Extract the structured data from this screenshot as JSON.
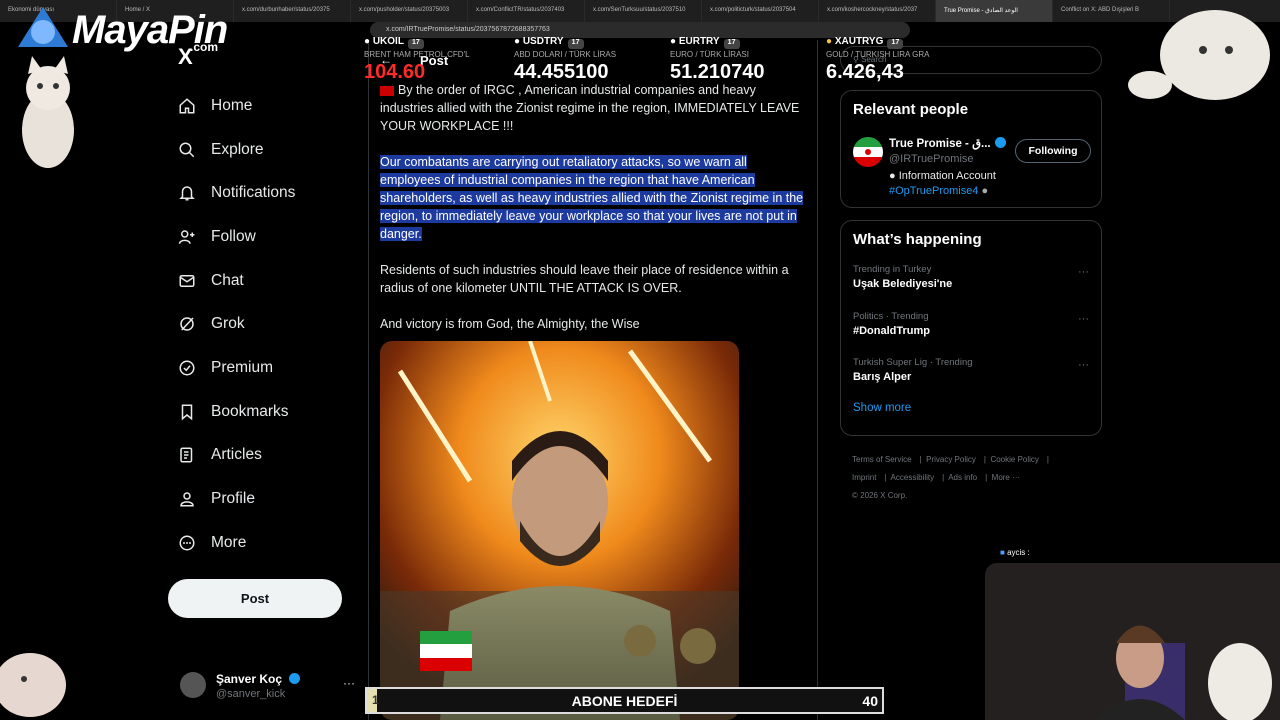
{
  "browser": {
    "tabs": [
      "Ekonomi dünyası",
      "Home / X",
      "x.com/durbunhaber/status/20375",
      "x.com/pusholder/status/20375003",
      "x.com/ConflictTR/status/2037403",
      "x.com/SenTurksuu/status/2037510",
      "x.com/politicturk/status/2037504",
      "x.com/koshercockney/status/2037",
      "True Promise - الوعد الصادق",
      "Conflict on X: ABD Dışişleri B"
    ],
    "url": "x.com/IRTruePromise/status/2037567872688357763"
  },
  "overlay": {
    "logo_text": "MayaPin",
    "logo_suffix": ".com",
    "sub_goal_label": "ABONE HEDEFİ",
    "sub_goal_start": "1",
    "sub_goal_target": "40",
    "sub_goal_progress": 0.01,
    "chat_user": "aycis :"
  },
  "ticker": [
    {
      "symbol": "UKOIL",
      "desc": "BRENT HAM PETROL CFD'L",
      "value": "104.60",
      "color": "#ff2a2a"
    },
    {
      "symbol": "USDTRY",
      "desc": "ABD DOLARI / TÜRK LİRAS",
      "value": "44.455100",
      "color": "#ffffff"
    },
    {
      "symbol": "EURTRY",
      "desc": "EURO / TÜRK LİRASI",
      "value": "51.210740",
      "color": "#ffffff"
    },
    {
      "symbol": "XAUTRYG",
      "desc": "GOLD / TURKISH LIRA GRA",
      "value": "6.426,43",
      "color": "#ffffff"
    }
  ],
  "sidebar": {
    "logo": "X",
    "items": [
      {
        "label": "Home",
        "icon": "home-icon"
      },
      {
        "label": "Explore",
        "icon": "search-icon"
      },
      {
        "label": "Notifications",
        "icon": "bell-icon"
      },
      {
        "label": "Follow",
        "icon": "add-person-icon"
      },
      {
        "label": "Chat",
        "icon": "mail-icon"
      },
      {
        "label": "Grok",
        "icon": "grok-icon"
      },
      {
        "label": "Premium",
        "icon": "verified-icon"
      },
      {
        "label": "Bookmarks",
        "icon": "bookmark-icon"
      },
      {
        "label": "Articles",
        "icon": "article-icon"
      },
      {
        "label": "Profile",
        "icon": "person-icon"
      },
      {
        "label": "More",
        "icon": "more-circle-icon"
      }
    ],
    "post_label": "Post",
    "account": {
      "name": "Şanver Koç",
      "handle": "@sanver_kick",
      "more": "···"
    }
  },
  "main": {
    "header_title": "Post",
    "paragraphs": [
      "By the order of IRGC , American industrial companies and heavy industries allied with the Zionist regime in the region, IMMEDIATELY LEAVE YOUR WORKPLACE !!!",
      "Our combatants are carrying out retaliatory attacks, so we warn all employees of industrial companies in the region that have American shareholders, as well as heavy industries allied with the Zionist regime in the region, to immediately leave your workplace so that your lives are not put in danger.",
      "Residents of such industries should leave their place of residence within a radius of one kilometer UNTIL THE ATTACK IS OVER.",
      "And victory is from God, the Almighty, the Wise"
    ]
  },
  "right": {
    "search_placeholder": "Search",
    "relevant_title": "Relevant people",
    "person": {
      "name": "True Promise - ق...",
      "handle": "@IRTruePromise",
      "bio": "Information Account",
      "tag": "#OpTruePromise4",
      "follow_label": "Following"
    },
    "happening_title": "What’s happening",
    "trends": [
      {
        "meta": "Trending in Turkey",
        "name": "Uşak Belediyesi'ne"
      },
      {
        "meta": "Politics · Trending",
        "name": "#DonaldTrump"
      },
      {
        "meta": "Turkish Super Lig · Trending",
        "name": "Barış Alper"
      }
    ],
    "show_more": "Show more",
    "footer": [
      "Terms of Service",
      "Privacy Policy",
      "Cookie Policy",
      "Imprint",
      "Accessibility",
      "Ads info",
      "More ···",
      "© 2026 X Corp."
    ]
  }
}
